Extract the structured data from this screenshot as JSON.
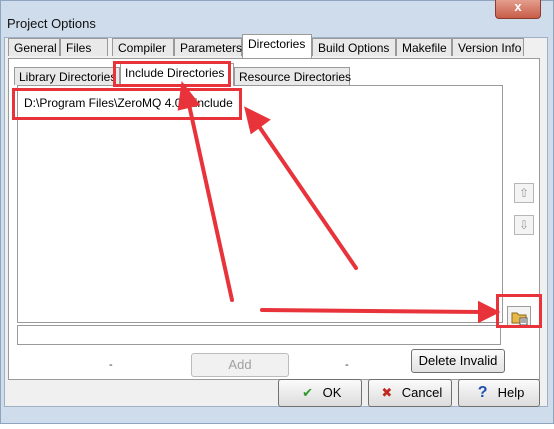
{
  "window": {
    "title": "Project Options",
    "close_label": "x"
  },
  "tabs": [
    {
      "label": "General"
    },
    {
      "label": "Files"
    },
    {
      "label": "Compiler"
    },
    {
      "label": "Parameters"
    },
    {
      "label": "Directories"
    },
    {
      "label": "Build Options"
    },
    {
      "label": "Makefile"
    },
    {
      "label": "Version Info"
    }
  ],
  "subtabs": [
    {
      "label": "Library Directories"
    },
    {
      "label": "Include Directories"
    },
    {
      "label": "Resource Directories"
    }
  ],
  "directories": {
    "item": "D:\\Program Files\\ZeroMQ 4.0.4\\include"
  },
  "buttons": {
    "move_up": "⇧",
    "move_down": "⇩",
    "add": "Add",
    "delete_invalid": "Delete Invalid",
    "dash": "-"
  },
  "footer": {
    "ok": "OK",
    "cancel": "Cancel",
    "help": "Help",
    "ok_icon": "✔",
    "cancel_icon": "✖",
    "help_icon": "?"
  },
  "colors": {
    "annotation": "#e8333a"
  }
}
